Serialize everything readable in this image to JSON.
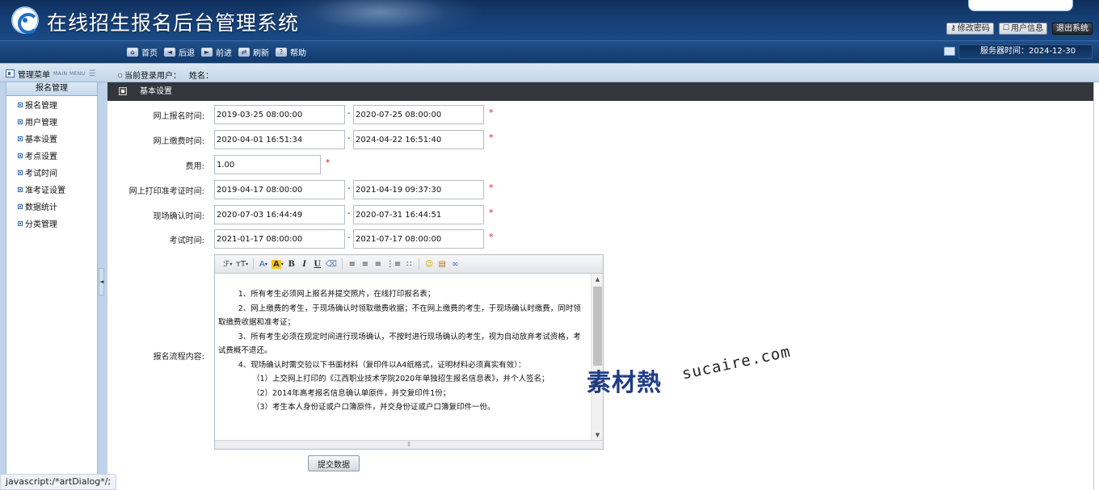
{
  "header": {
    "app_title": "在线招生报名后台管理系统",
    "top_links": [
      {
        "label": "修改密码",
        "icon": "key-icon"
      },
      {
        "label": "用户信息",
        "icon": "user-icon"
      },
      {
        "label": "退出系统",
        "icon": "exit-icon"
      }
    ]
  },
  "nav": {
    "items": [
      {
        "label": "首页",
        "icon": "home-icon",
        "glyph": "⌂"
      },
      {
        "label": "后退",
        "icon": "back-arrow-icon",
        "glyph": "◄"
      },
      {
        "label": "前进",
        "icon": "forward-arrow-icon",
        "glyph": "►"
      },
      {
        "label": "刷新",
        "icon": "refresh-icon",
        "glyph": "⇄"
      },
      {
        "label": "帮助",
        "icon": "help-icon",
        "glyph": "?"
      }
    ],
    "server_time_label": "服务器时间：2024-12-30"
  },
  "subbar": {
    "menu_title": "管理菜单",
    "menu_title_en": "MAIN MENU",
    "current_user_label": "当前登录用户：",
    "name_label": "姓名："
  },
  "sidebar": {
    "header": "报名管理",
    "items": [
      "报名管理",
      "用户管理",
      "基本设置",
      "考点设置",
      "考试时间",
      "准考证设置",
      "数据统计",
      "分类管理"
    ]
  },
  "main": {
    "section_title": "基本设置",
    "rows": [
      {
        "label": "网上报名时间:",
        "start": "2019-03-25 08:00:00",
        "end": "2020-07-25 08:00:00",
        "required": "*"
      },
      {
        "label": "网上缴费时间:",
        "start": "2020-04-01 16:51:34",
        "end": "2024-04-22 16:51:40",
        "required": "*"
      },
      {
        "label": "费用:",
        "start": "1.00",
        "end": null,
        "required": "*"
      },
      {
        "label": "网上打印准考证时间:",
        "start": "2019-04-17 08:00:00",
        "end": "2021-04-19 09:37:30",
        "required": "*"
      },
      {
        "label": "现场确认时间:",
        "start": "2020-07-03 16:44:49",
        "end": "2020-07-31 16:44:51",
        "required": "*"
      },
      {
        "label": "考试时间:",
        "start": "2021-01-17 08:00:00",
        "end": "2021-07-17 08:00:00",
        "required": "*"
      }
    ],
    "dash": "-",
    "flow_label": "报名流程内容:",
    "editor_paragraphs": [
      "1、所有考生必须网上报名并提交照片，在线打印报名表；",
      "2、网上缴费的考生，于现场确认时领取缴费收据；不在网上缴费的考生，于现场确认时缴费，同时领取缴费收据和准考证；",
      "3、所有考生必须在规定时间进行现场确认，不按时进行现场确认的考生，视为自动放弃考试资格，考试费概不退还。",
      "4、现场确认时需交验以下书面材料（复印件以A4纸格式，证明材料必须真实有效）："
    ],
    "editor_subitems": [
      "（1）上交网上打印的《江西职业技术学院2020年单独招生报名信息表》，并个人签名；",
      "（2）2014年高考报名信息确认单原件，并交复印件1份；",
      "（3）考生本人身份证或户口簿原件，并交身份证或户口簿复印件一份。"
    ],
    "toolbar": {
      "font_family": "ℱ",
      "font_size": "тT",
      "font_color": "A",
      "highlight": "A",
      "bold": "B",
      "italic": "I",
      "underline": "U"
    },
    "submit_label": "提交数据"
  },
  "watermark": {
    "cn": "素材熱",
    "en": "sucaire.com"
  },
  "status_bar": "javascript:/*artDialog*/;",
  "colors": {
    "header_bg": "#153d72",
    "nav_bg": "#1a4a85",
    "section_bar": "#33373d",
    "required": "#e02020"
  }
}
